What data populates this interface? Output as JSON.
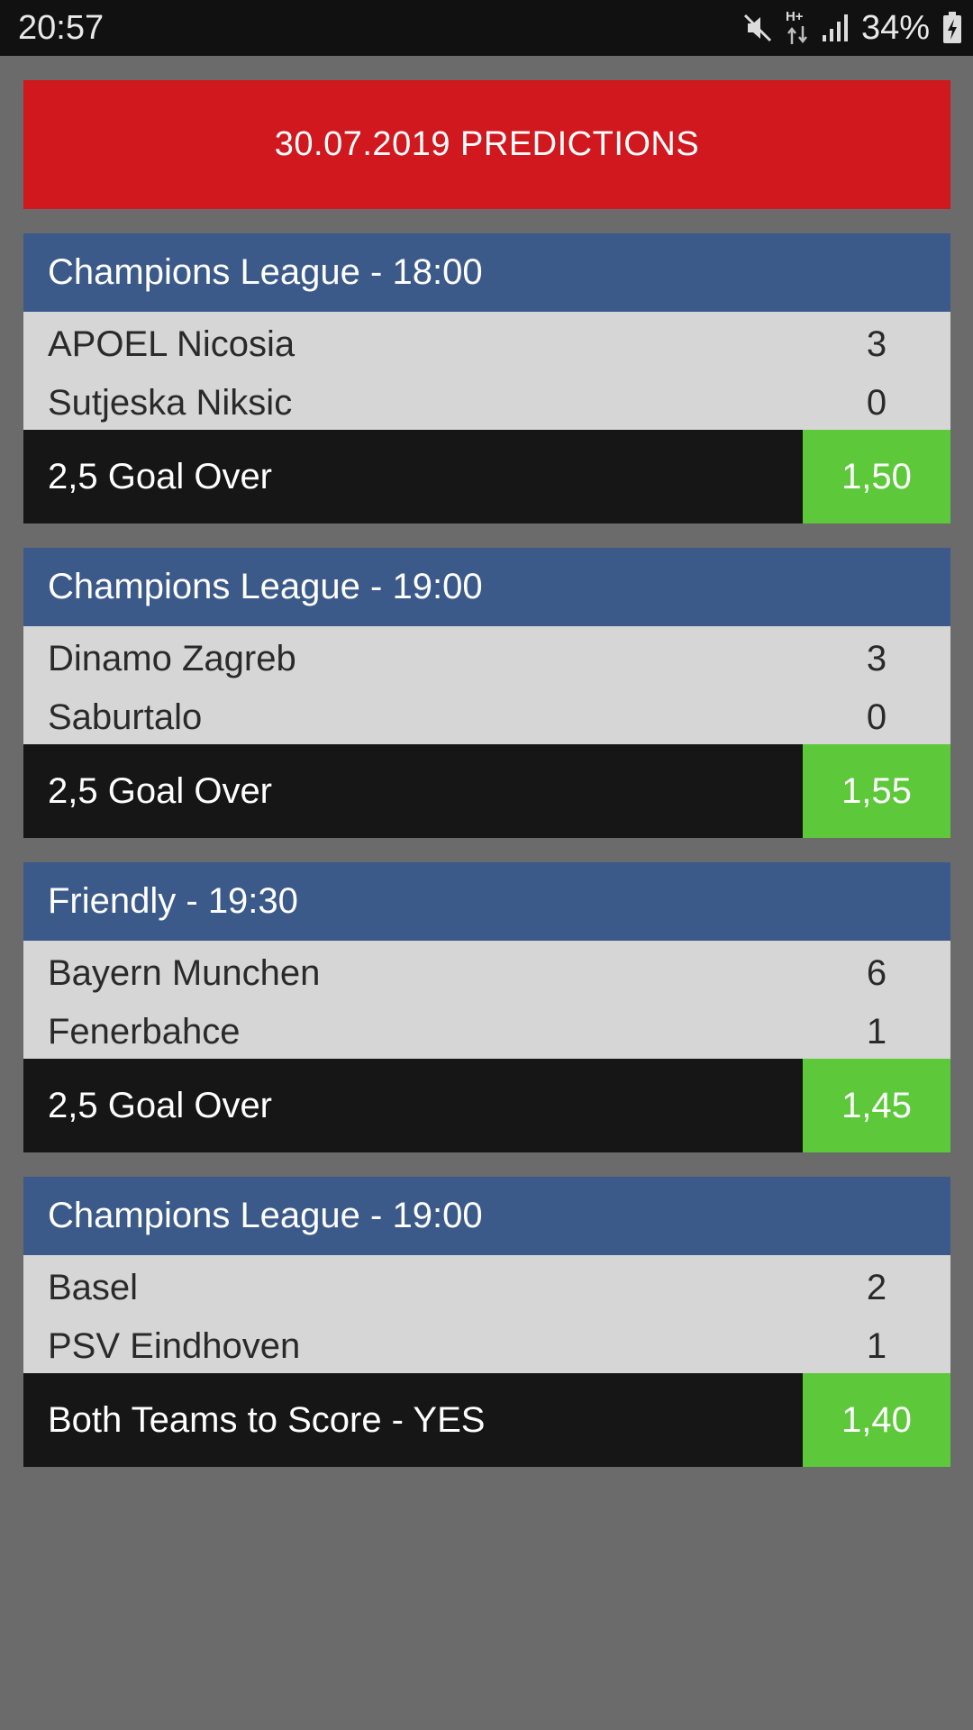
{
  "status_bar": {
    "time": "20:57",
    "network": "H+",
    "battery": "34%",
    "icons": [
      "mute-icon",
      "network-arrows-icon",
      "signal-icon",
      "battery-charging-icon"
    ]
  },
  "banner": {
    "title": "30.07.2019 PREDICTIONS"
  },
  "colors": {
    "banner": "#d0181e",
    "header": "#3b5a8a",
    "teams_bg": "#d6d6d6",
    "pick_bg": "#161616",
    "odds_bg": "#5cc83a",
    "page_bg": "#6b6b6b"
  },
  "matches": [
    {
      "header": "Champions League - 18:00",
      "home": "APOEL Nicosia",
      "home_score": "3",
      "away": "Sutjeska Niksic",
      "away_score": "0",
      "pick": "2,5 Goal Over",
      "odds": "1,50"
    },
    {
      "header": "Champions League - 19:00",
      "home": "Dinamo Zagreb",
      "home_score": "3",
      "away": "Saburtalo",
      "away_score": "0",
      "pick": "2,5 Goal Over",
      "odds": "1,55"
    },
    {
      "header": "Friendly - 19:30",
      "home": "Bayern Munchen",
      "home_score": "6",
      "away": "Fenerbahce",
      "away_score": "1",
      "pick": "2,5 Goal Over",
      "odds": "1,45"
    },
    {
      "header": "Champions League - 19:00",
      "home": "Basel",
      "home_score": "2",
      "away": "PSV Eindhoven",
      "away_score": "1",
      "pick": "Both Teams to Score - YES",
      "odds": "1,40"
    }
  ]
}
